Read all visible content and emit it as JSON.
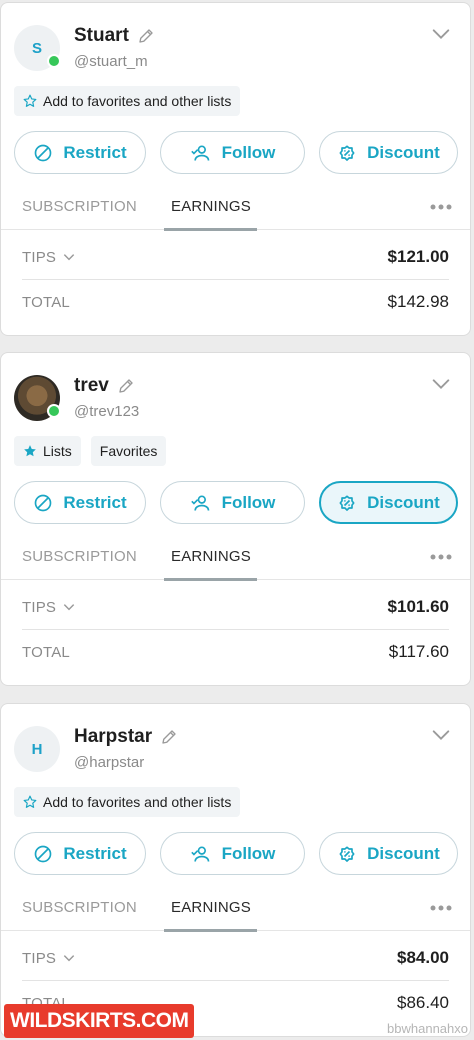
{
  "colors": {
    "accent": "#1aa6c4",
    "online": "#36c759",
    "watermark": "#e83b2c"
  },
  "cards": [
    {
      "initial": "S",
      "name": "Stuart",
      "handle": "@stuart_m",
      "tags": [
        "Add to favorites and other lists"
      ],
      "buttons": {
        "restrict": "Restrict",
        "follow": "Follow",
        "discount": "Discount"
      },
      "tabs": {
        "subscription": "SUBSCRIPTION",
        "earnings": "EARNINGS"
      },
      "tips_label": "TIPS",
      "tips_value": "$121.00",
      "total_label": "TOTAL",
      "total_value": "$142.98"
    },
    {
      "initial": "",
      "name": "trev",
      "handle": "@trev123",
      "tags": [
        "Lists",
        "Favorites"
      ],
      "buttons": {
        "restrict": "Restrict",
        "follow": "Follow",
        "discount": "Discount"
      },
      "tabs": {
        "subscription": "SUBSCRIPTION",
        "earnings": "EARNINGS"
      },
      "tips_label": "TIPS",
      "tips_value": "$101.60",
      "total_label": "TOTAL",
      "total_value": "$117.60"
    },
    {
      "initial": "H",
      "name": "Harpstar",
      "handle": "@harpstar",
      "tags": [
        "Add to favorites and other lists"
      ],
      "buttons": {
        "restrict": "Restrict",
        "follow": "Follow",
        "discount": "Discount"
      },
      "tabs": {
        "subscription": "SUBSCRIPTION",
        "earnings": "EARNINGS"
      },
      "tips_label": "TIPS",
      "tips_value": "$84.00",
      "total_label": "TOTAL",
      "total_value": "$86.40"
    }
  ],
  "watermarks": {
    "left": "WILDSKIRTS.COM",
    "right": "bbwhannahxo"
  }
}
